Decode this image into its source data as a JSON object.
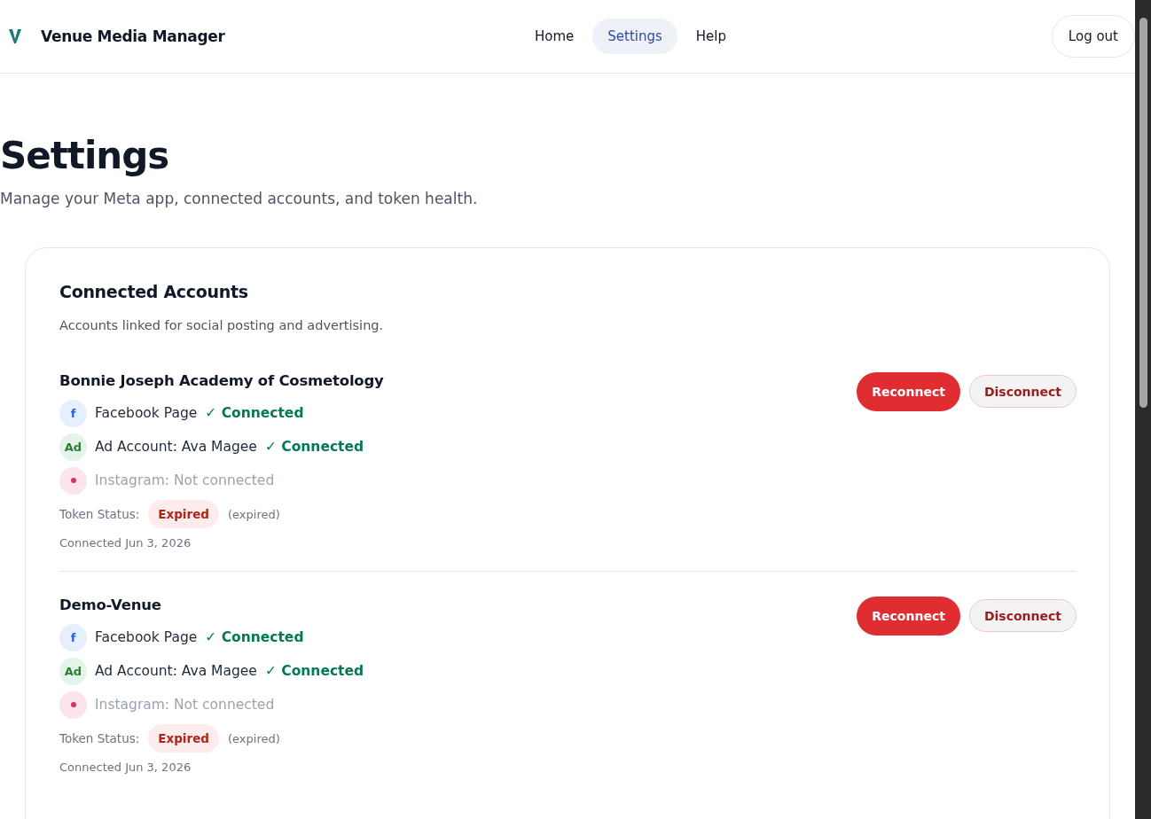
{
  "header": {
    "app_name": "Venue Media Manager",
    "nav": [
      {
        "label": "Home",
        "selected": false
      },
      {
        "label": "Settings",
        "selected": true
      },
      {
        "label": "Help",
        "selected": false
      }
    ],
    "logout": "Log out"
  },
  "page": {
    "title": "Settings",
    "subtitle": "Manage your Meta app, connected accounts, and token health."
  },
  "card": {
    "title": "Connected Accounts",
    "description": "Accounts linked for social posting and advertising.",
    "accounts": [
      {
        "name": "Bonnie Joseph Academy of Cosmetology",
        "services": [
          {
            "kind": "facebook",
            "badge": "f",
            "label": "Facebook Page",
            "connected": true,
            "status": "✓ Connected"
          },
          {
            "kind": "ad",
            "badge": "Ad",
            "label": "Ad Account: Ava Magee",
            "connected": true,
            "status": "✓ Connected"
          },
          {
            "kind": "instagram",
            "label": "Instagram: Not connected",
            "connected": false
          }
        ],
        "token_label": "Token Status:",
        "token_badge": "Expired",
        "token_note": "(expired)",
        "connected_on": "Connected Jun 3, 2026",
        "buttons": [
          "Reconnect",
          "Disconnect"
        ]
      },
      {
        "name": "Demo-Venue",
        "services": [
          {
            "kind": "facebook",
            "badge": "f",
            "label": "Facebook Page",
            "connected": true,
            "status": "✓ Connected"
          },
          {
            "kind": "ad",
            "badge": "Ad",
            "label": "Ad Account: Ava Magee",
            "connected": true,
            "status": "✓ Connected"
          },
          {
            "kind": "instagram",
            "label": "Instagram: Not connected",
            "connected": false
          }
        ],
        "token_label": "Token Status:",
        "token_badge": "Expired",
        "token_note": "(expired)",
        "connected_on": "Connected Jun 3, 2026",
        "buttons": [
          "Reconnect",
          "Disconnect"
        ]
      }
    ]
  }
}
